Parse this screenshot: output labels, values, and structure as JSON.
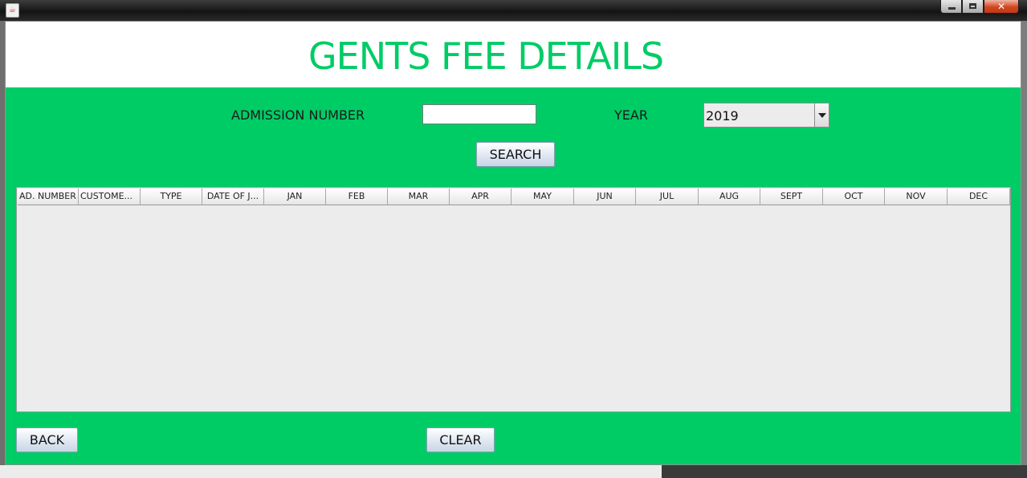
{
  "window": {
    "title": "",
    "close_glyph": "✕",
    "accent": "#00cc66"
  },
  "header": {
    "title": "GENTS FEE DETAILS"
  },
  "form": {
    "admission_label": "ADMISSION NUMBER",
    "admission_value": "",
    "year_label": "YEAR",
    "year_value": "2019",
    "search_label": "SEARCH"
  },
  "table": {
    "columns": [
      "AD. NUMBER",
      "CUSTOME...",
      "TYPE",
      "DATE OF J...",
      "JAN",
      "FEB",
      "MAR",
      "APR",
      "MAY",
      "JUN",
      "JUL",
      "AUG",
      "SEPT",
      "OCT",
      "NOV",
      "DEC"
    ],
    "rows": []
  },
  "footer": {
    "back_label": "BACK",
    "clear_label": "CLEAR"
  }
}
